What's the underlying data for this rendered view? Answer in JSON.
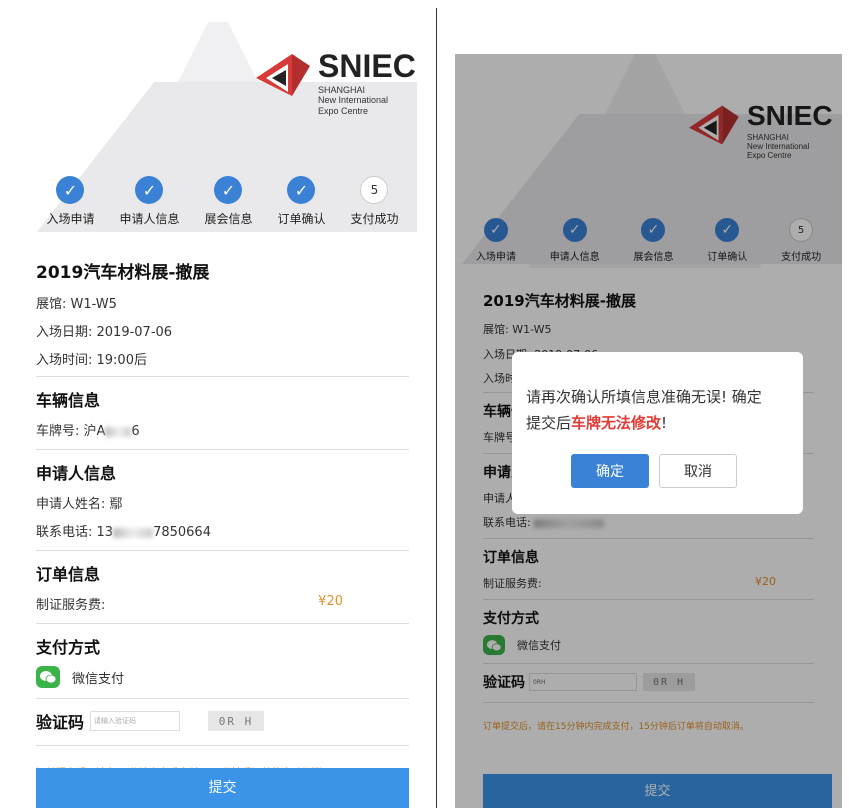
{
  "logo": {
    "title": "SNIEC",
    "sub1": "SHANGHAI",
    "sub2": "New International",
    "sub3": "Expo Centre"
  },
  "steps": [
    {
      "label": "入场申请",
      "done": true
    },
    {
      "label": "申请人信息",
      "done": true
    },
    {
      "label": "展会信息",
      "done": true
    },
    {
      "label": "订单确认",
      "done": true
    },
    {
      "label": "支付成功",
      "number": "5",
      "done": false
    }
  ],
  "event": {
    "title": "2019汽车材料展-撤展",
    "hall": "展馆: W1-W5",
    "date": "入场日期: 2019-07-06",
    "time": "入场时间: 19:00后"
  },
  "vehicle": {
    "title": "车辆信息",
    "plate_label": "车牌号: 沪A",
    "plate_tail": "6"
  },
  "applicant": {
    "title": "申请人信息",
    "name_label": "申请人姓名: ",
    "name_partial": "鄢",
    "phone_label": "联系电话: ",
    "phone_left": "13",
    "phone_right": "7850664"
  },
  "order": {
    "title": "订单信息",
    "fee_label": "制证服务费:",
    "fee_value": "¥20"
  },
  "payment": {
    "title": "支付方式",
    "method": "微信支付"
  },
  "captcha": {
    "label": "验证码",
    "placeholder_left": "请输入验证码",
    "value_right": "0RH",
    "image_text": "0R H"
  },
  "notice": "订单提交后，请在15分钟内完成支付，15分钟后订单将自动取消。",
  "submit_label": "提交",
  "dialog": {
    "text_line1": "请再次确认所填信息准确无误! 确定",
    "text_prefix": "提交后",
    "text_red": "车牌无法修改",
    "text_suffix": "!",
    "ok_label": "确定",
    "cancel_label": "取消"
  },
  "colors": {
    "primary": "#3b82d6",
    "submit": "#3b94e8",
    "fee": "#e3902c",
    "warn_red": "#e23b36",
    "wechat": "#3cb34a"
  }
}
